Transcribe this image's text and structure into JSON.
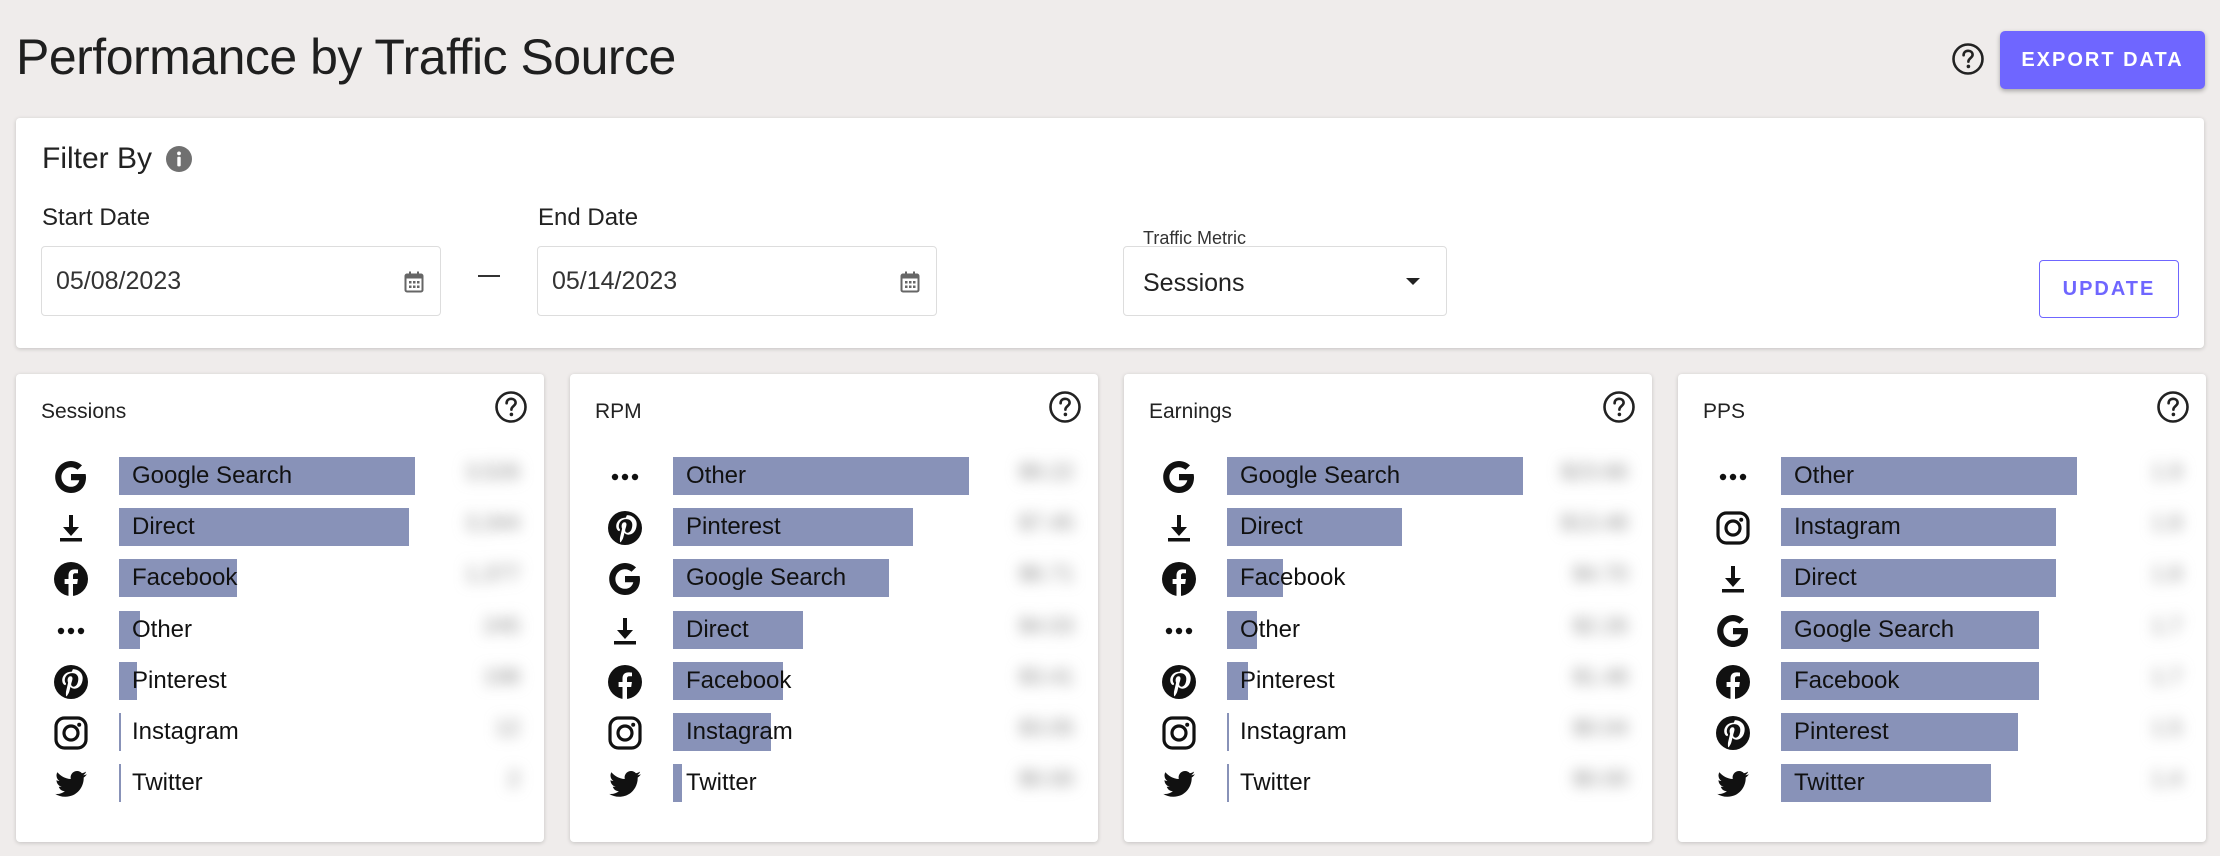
{
  "page": {
    "title": "Performance by Traffic Source",
    "export_label": "EXPORT DATA"
  },
  "filter": {
    "title": "Filter By",
    "start_date_label": "Start Date",
    "start_date_value": "05/08/2023",
    "end_date_label": "End Date",
    "end_date_value": "05/14/2023",
    "metric_label": "Traffic Metric",
    "metric_value": "Sessions",
    "update_label": "UPDATE"
  },
  "colors": {
    "accent": "#6f66ff",
    "bar": "#8892b8",
    "background": "#efeceb"
  },
  "cards": [
    {
      "title": "Sessions",
      "rows": [
        {
          "source": "Google Search",
          "icon": "google-icon",
          "share": 1.0,
          "value": "3,526"
        },
        {
          "source": "Direct",
          "icon": "download-icon",
          "share": 0.98,
          "value": "3,344"
        },
        {
          "source": "Facebook",
          "icon": "facebook-icon",
          "share": 0.4,
          "value": "1,377"
        },
        {
          "source": "Other",
          "icon": "more-icon",
          "share": 0.07,
          "value": "245"
        },
        {
          "source": "Pinterest",
          "icon": "pinterest-icon",
          "share": 0.06,
          "value": "198"
        },
        {
          "source": "Instagram",
          "icon": "instagram-icon",
          "share": 0.0,
          "value": "12"
        },
        {
          "source": "Twitter",
          "icon": "twitter-icon",
          "share": 0.0,
          "value": "2"
        }
      ]
    },
    {
      "title": "RPM",
      "rows": [
        {
          "source": "Other",
          "icon": "more-icon",
          "share": 1.0,
          "value": "$9.22"
        },
        {
          "source": "Pinterest",
          "icon": "pinterest-icon",
          "share": 0.81,
          "value": "$7.45"
        },
        {
          "source": "Google Search",
          "icon": "google-icon",
          "share": 0.73,
          "value": "$6.71"
        },
        {
          "source": "Direct",
          "icon": "download-icon",
          "share": 0.44,
          "value": "$4.03"
        },
        {
          "source": "Facebook",
          "icon": "facebook-icon",
          "share": 0.37,
          "value": "$3.41"
        },
        {
          "source": "Instagram",
          "icon": "instagram-icon",
          "share": 0.33,
          "value": "$3.05"
        },
        {
          "source": "Twitter",
          "icon": "twitter-icon",
          "share": 0.03,
          "value": "$0.00"
        }
      ]
    },
    {
      "title": "Earnings",
      "rows": [
        {
          "source": "Google Search",
          "icon": "google-icon",
          "share": 1.0,
          "value": "$23.66"
        },
        {
          "source": "Direct",
          "icon": "download-icon",
          "share": 0.59,
          "value": "$13.48"
        },
        {
          "source": "Facebook",
          "icon": "facebook-icon",
          "share": 0.19,
          "value": "$4.70"
        },
        {
          "source": "Other",
          "icon": "more-icon",
          "share": 0.1,
          "value": "$2.26"
        },
        {
          "source": "Pinterest",
          "icon": "pinterest-icon",
          "share": 0.07,
          "value": "$1.48"
        },
        {
          "source": "Instagram",
          "icon": "instagram-icon",
          "share": 0.0,
          "value": "$0.04"
        },
        {
          "source": "Twitter",
          "icon": "twitter-icon",
          "share": 0.0,
          "value": "$0.00"
        }
      ]
    },
    {
      "title": "PPS",
      "rows": [
        {
          "source": "Other",
          "icon": "more-icon",
          "share": 1.0,
          "value": "1.9"
        },
        {
          "source": "Instagram",
          "icon": "instagram-icon",
          "share": 0.93,
          "value": "1.8"
        },
        {
          "source": "Direct",
          "icon": "download-icon",
          "share": 0.93,
          "value": "1.8"
        },
        {
          "source": "Google Search",
          "icon": "google-icon",
          "share": 0.87,
          "value": "1.7"
        },
        {
          "source": "Facebook",
          "icon": "facebook-icon",
          "share": 0.87,
          "value": "1.7"
        },
        {
          "source": "Pinterest",
          "icon": "pinterest-icon",
          "share": 0.8,
          "value": "1.5"
        },
        {
          "source": "Twitter",
          "icon": "twitter-icon",
          "share": 0.71,
          "value": "1.4"
        }
      ]
    }
  ]
}
